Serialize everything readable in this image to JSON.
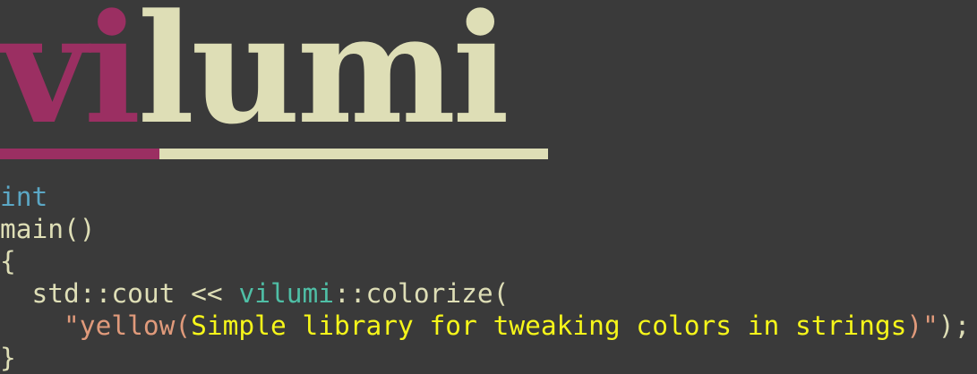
{
  "logo": {
    "part_vi": "vi",
    "part_lumi": "lumi",
    "colors": {
      "vi": "#9b2f62",
      "lumi": "#dedeb6"
    }
  },
  "code": {
    "line1": {
      "type": "int"
    },
    "line2": {
      "fn": "main()"
    },
    "line3": {
      "brace_open": "{"
    },
    "line4": {
      "indent": "  ",
      "std_cout": "std::cout",
      "op": " << ",
      "ns": "vilumi",
      "scope": "::colorize("
    },
    "line5": {
      "indent": "    ",
      "str_open": "\"yellow(",
      "text": "Simple library for tweaking colors in strings",
      "str_close": ")\"",
      "end": ");"
    },
    "line6": {
      "brace_close": "}"
    }
  },
  "colors": {
    "background": "#3a3a3a",
    "keyword": "#5ba7c5",
    "namespace": "#4fbfa6",
    "string": "#e09a7b",
    "yellow_text": "#f6f61a",
    "default_text": "#dedeb6"
  }
}
